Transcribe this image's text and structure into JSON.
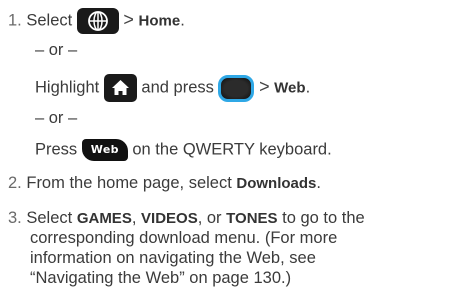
{
  "step1": {
    "number": "1.",
    "select": "Select",
    "separator": ">",
    "home": "Home",
    "period": "."
  },
  "or1": "– or –",
  "highlight_line": {
    "highlight": "Highlight",
    "and_press": "and press",
    "separator": ">",
    "web": "Web",
    "period": "."
  },
  "or2": "– or –",
  "press_line": {
    "press": "Press",
    "web_key_label": "Web",
    "rest": "on the QWERTY keyboard."
  },
  "step2": {
    "number": "2.",
    "text": "From the home page, select",
    "downloads": "Downloads",
    "period": "."
  },
  "step3": {
    "number": "3.",
    "select": "Select",
    "games": "GAMES",
    "comma1": ",",
    "videos": "VIDEOS",
    "or_text": ", or",
    "tones": "TONES",
    "rest": "to go to the",
    "line2": "corresponding download menu. (For more",
    "line3": "information on navigating the Web, see",
    "line4": "“Navigating the Web” on page 130.)"
  },
  "icons": {
    "globe_key": "globe-icon",
    "home_key": "home-icon",
    "nav_key": "navigation-key-icon",
    "web_key": "web-key-icon"
  },
  "colors": {
    "text": "#3b3b3b",
    "key_background": "#1a1a1a",
    "nav_key_ring": "#2fa8e6"
  }
}
